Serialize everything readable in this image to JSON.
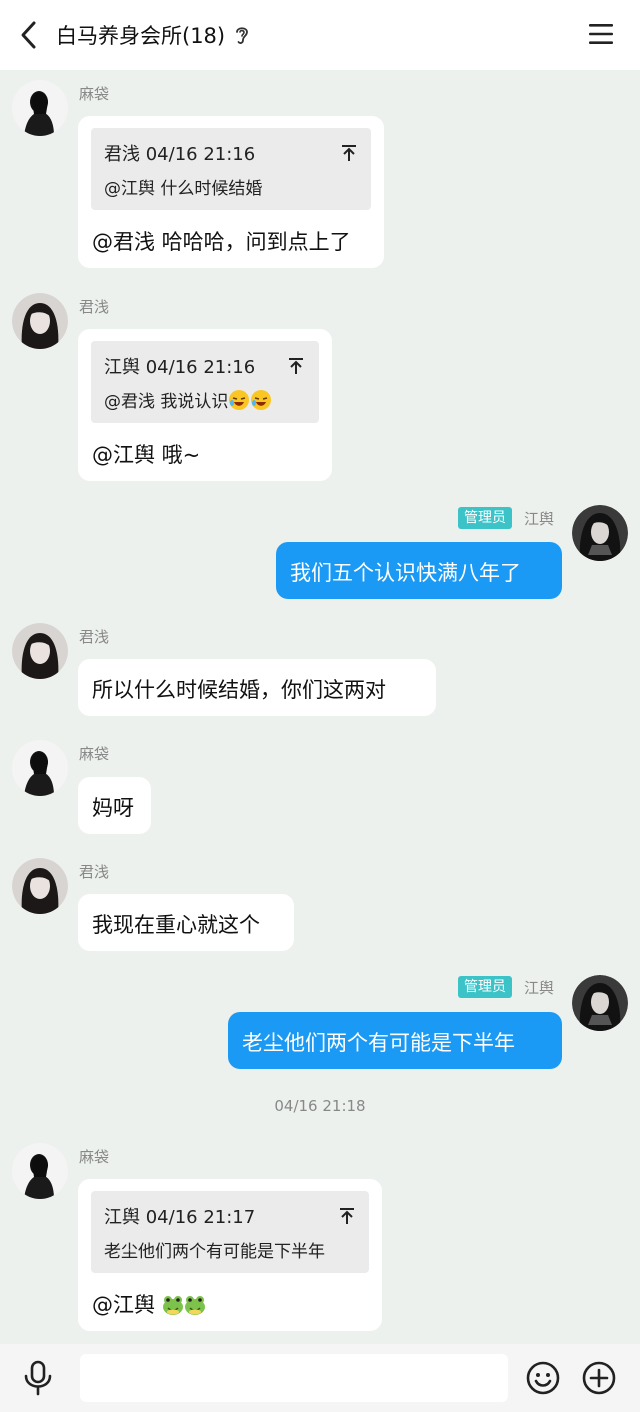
{
  "header": {
    "back_icon": "chevron-left-icon",
    "title": "白马养身会所(18)",
    "ear_icon": "ear-icon",
    "menu_icon": "hamburger-menu-icon"
  },
  "messages": [
    {
      "sender": "麻袋",
      "side": "left",
      "quote": {
        "head": "君浅 04/16 21:16",
        "body": "@江舆 什么时候结婚"
      },
      "text": "@君浅 哈哈哈，问到点上了"
    },
    {
      "sender": "君浅",
      "side": "left",
      "quote": {
        "head": "江舆 04/16 21:16",
        "body": "@君浅 我说认识"
      },
      "text": "@江舆 哦~"
    },
    {
      "sender": "江舆",
      "badge": "管理员",
      "side": "right",
      "text": "我们五个认识快满八年了"
    },
    {
      "sender": "君浅",
      "side": "left",
      "text": "所以什么时候结婚，你们这两对"
    },
    {
      "sender": "麻袋",
      "side": "left",
      "text": "妈呀"
    },
    {
      "sender": "君浅",
      "side": "left",
      "text": "我现在重心就这个"
    },
    {
      "sender": "江舆",
      "badge": "管理员",
      "side": "right",
      "text": "老尘他们两个有可能是下半年"
    },
    {
      "timestamp": "04/16 21:18"
    },
    {
      "sender": "麻袋",
      "side": "left",
      "quote": {
        "head": "江舆 04/16 21:17",
        "body": "老尘他们两个有可能是下半年"
      },
      "text": "@江舆"
    }
  ],
  "input_bar": {
    "mic_icon": "microphone-icon",
    "placeholder": "",
    "emoji_icon": "smiley-icon",
    "plus_icon": "plus-circle-icon"
  },
  "colors": {
    "background": "#edf1ee",
    "self_bubble": "#1a9af4",
    "admin_badge": "#3cc3c8"
  }
}
